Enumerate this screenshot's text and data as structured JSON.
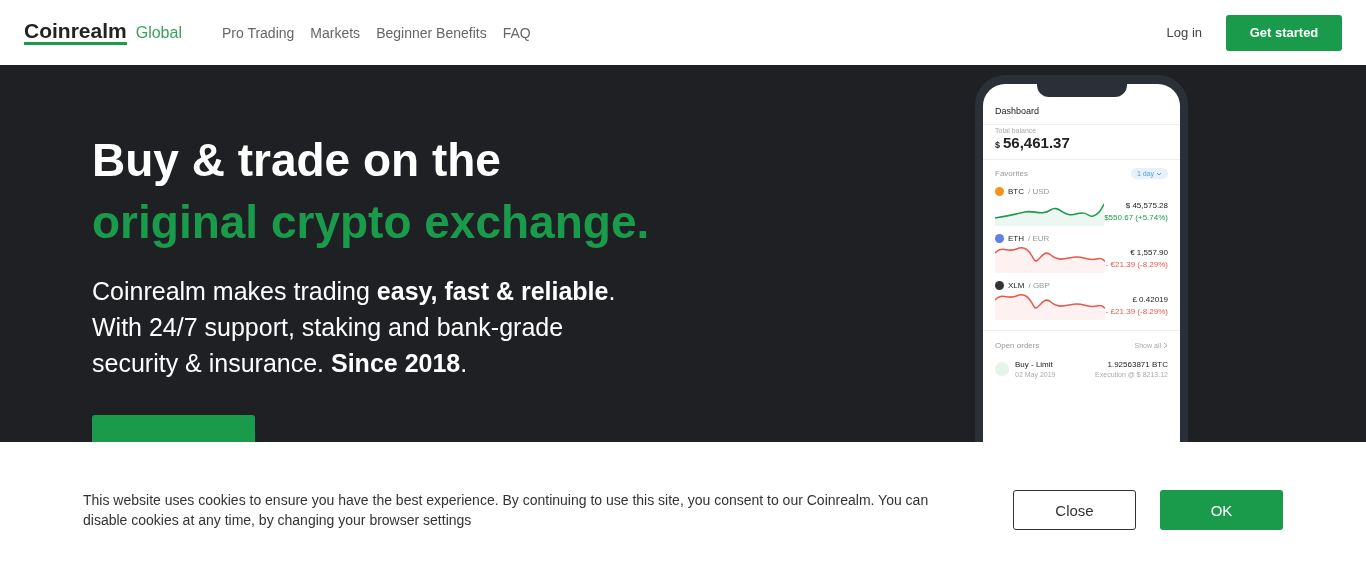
{
  "header": {
    "logo": "Coinrealm",
    "logo_suffix": "Global",
    "nav": [
      "Pro Trading",
      "Markets",
      "Beginner Benefits",
      "FAQ"
    ],
    "login": "Log in",
    "cta": "Get started"
  },
  "hero": {
    "title_line1": "Buy & trade on the",
    "title_line2": "original crypto exchange.",
    "body": "Coinrealm makes trading **easy, fast & reliable**. With 24/7 support, staking and bank-grade security & insurance. **Since 2018**."
  },
  "phone": {
    "title": "Dashboard",
    "balance_label": "Total balance",
    "currency": "$",
    "balance": "56,461.37",
    "favorites_label": "Favorites",
    "period": "1 day",
    "favorites": [
      {
        "symbol": "BTC",
        "pair": "/ USD",
        "price": "$ 45,575.28",
        "change": "$550.67 (+5.74%)",
        "color": "#1a9b4b"
      },
      {
        "symbol": "ETH",
        "pair": "/ EUR",
        "price": "€ 1,557.90",
        "change": "- €21.39 (-8.29%)",
        "color": "#e8574a"
      },
      {
        "symbol": "XLM",
        "pair": "/ GBP",
        "price": "£ 0.42019",
        "change": "- £21.39 (-8.29%)",
        "color": "#e8574a"
      }
    ],
    "orders_label": "Open orders",
    "show_all": "Show all",
    "order": {
      "type": "Buy - Limit",
      "date": "02 May 2019",
      "amount": "1.92563871 BTC",
      "execution": "Execution @ $ 8213.12"
    }
  },
  "cookie": {
    "text": "This website uses cookies to ensure you have the best experience. By continuing to use this site, you consent to our Coinrealm. You can disable cookies at any time, by changing your browser settings",
    "close": "Close",
    "ok": "OK"
  }
}
